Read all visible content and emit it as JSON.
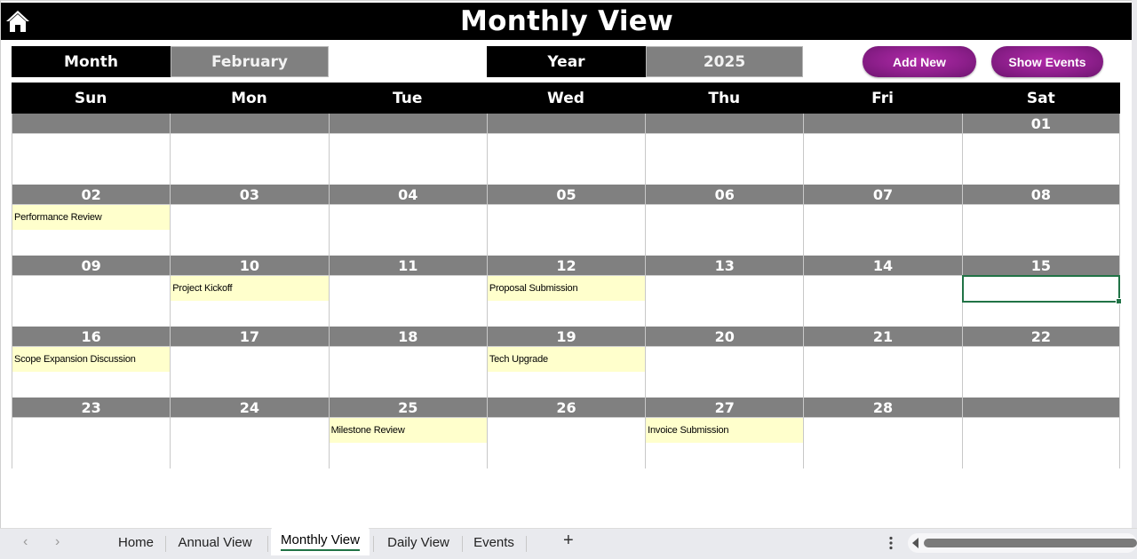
{
  "header": {
    "title": "Monthly View",
    "home_icon": "home-icon"
  },
  "controls": {
    "month_label": "Month",
    "month_value": "February",
    "year_label": "Year",
    "year_value": "2025",
    "add_new_label": "Add New",
    "show_events_label": "Show Events",
    "button_color": "#8e1f8c"
  },
  "calendar": {
    "weekdays": [
      "Sun",
      "Mon",
      "Tue",
      "Wed",
      "Thu",
      "Fri",
      "Sat"
    ],
    "header_color": "#808080",
    "event_color": "#ffffcc",
    "selected_day": "15",
    "weeks": [
      [
        {
          "day": "",
          "event": ""
        },
        {
          "day": "",
          "event": ""
        },
        {
          "day": "",
          "event": ""
        },
        {
          "day": "",
          "event": ""
        },
        {
          "day": "",
          "event": ""
        },
        {
          "day": "",
          "event": ""
        },
        {
          "day": "01",
          "event": ""
        }
      ],
      [
        {
          "day": "02",
          "event": "Performance Review"
        },
        {
          "day": "03",
          "event": ""
        },
        {
          "day": "04",
          "event": ""
        },
        {
          "day": "05",
          "event": ""
        },
        {
          "day": "06",
          "event": ""
        },
        {
          "day": "07",
          "event": ""
        },
        {
          "day": "08",
          "event": ""
        }
      ],
      [
        {
          "day": "09",
          "event": ""
        },
        {
          "day": "10",
          "event": "Project Kickoff"
        },
        {
          "day": "11",
          "event": ""
        },
        {
          "day": "12",
          "event": "Proposal Submission"
        },
        {
          "day": "13",
          "event": ""
        },
        {
          "day": "14",
          "event": ""
        },
        {
          "day": "15",
          "event": ""
        }
      ],
      [
        {
          "day": "16",
          "event": "Scope Expansion Discussion"
        },
        {
          "day": "17",
          "event": ""
        },
        {
          "day": "18",
          "event": ""
        },
        {
          "day": "19",
          "event": "Tech Upgrade"
        },
        {
          "day": "20",
          "event": ""
        },
        {
          "day": "21",
          "event": ""
        },
        {
          "day": "22",
          "event": ""
        }
      ],
      [
        {
          "day": "23",
          "event": ""
        },
        {
          "day": "24",
          "event": ""
        },
        {
          "day": "25",
          "event": "Milestone Review"
        },
        {
          "day": "26",
          "event": ""
        },
        {
          "day": "27",
          "event": "Invoice Submission"
        },
        {
          "day": "28",
          "event": ""
        },
        {
          "day": "",
          "event": ""
        }
      ]
    ]
  },
  "sheet_tabs": {
    "tabs": [
      {
        "label": "Home",
        "active": false
      },
      {
        "label": "Annual View",
        "active": false
      },
      {
        "label": "Monthly View",
        "active": true
      },
      {
        "label": "Daily View",
        "active": false
      },
      {
        "label": "Events",
        "active": false
      }
    ],
    "prev_icon": "‹",
    "next_icon": "›",
    "add_icon": "+",
    "active_color": "#217346"
  }
}
